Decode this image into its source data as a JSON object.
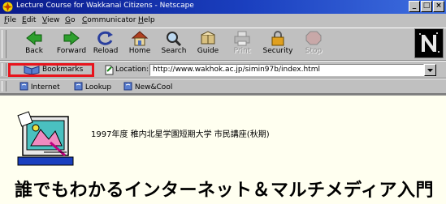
{
  "window": {
    "title": "Lecture Course for Wakkanai Citizens - Netscape",
    "controls": [
      "_",
      "□",
      "×"
    ]
  },
  "menubar": {
    "items": [
      {
        "key": "F",
        "rest": "ile"
      },
      {
        "key": "E",
        "rest": "dit"
      },
      {
        "key": "V",
        "rest": "iew"
      },
      {
        "key": "G",
        "rest": "o"
      },
      {
        "key": "C",
        "rest": "ommunicator"
      },
      {
        "key": "H",
        "rest": "elp"
      }
    ]
  },
  "toolbar": {
    "buttons": [
      {
        "label": "Back",
        "icon": "back-arrow-icon",
        "enabled": true
      },
      {
        "label": "Forward",
        "icon": "forward-arrow-icon",
        "enabled": true
      },
      {
        "label": "Reload",
        "icon": "reload-icon",
        "enabled": true
      },
      {
        "label": "Home",
        "icon": "home-icon",
        "enabled": true
      },
      {
        "label": "Search",
        "icon": "search-icon",
        "enabled": true
      },
      {
        "label": "Guide",
        "icon": "guide-icon",
        "enabled": true
      },
      {
        "label": "Print",
        "icon": "printer-icon",
        "enabled": false
      },
      {
        "label": "Security",
        "icon": "lock-icon",
        "enabled": true
      },
      {
        "label": "Stop",
        "icon": "stop-icon",
        "enabled": false
      }
    ]
  },
  "locationbar": {
    "bookmarks_label": "Bookmarks",
    "location_label": "Location:",
    "url": "http://www.wakhok.ac.jp/simin97b/index.html"
  },
  "personal_toolbar": {
    "links": [
      "Internet",
      "Lookup",
      "New&Cool"
    ]
  },
  "page": {
    "subtitle": "1997年度  稚内北星学園短期大学  市民講座(秋期)",
    "title": "誰でもわかるインターネット＆マルチメディア入門"
  },
  "colors": {
    "highlight_box": "#e8141c",
    "titlebar": "#0a1a8a",
    "content_background": "#fffff0"
  }
}
